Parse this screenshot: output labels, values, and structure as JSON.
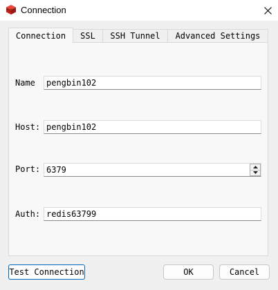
{
  "window": {
    "title": "Connection"
  },
  "tabs": [
    "Connection",
    "SSL",
    "SSH Tunnel",
    "Advanced Settings"
  ],
  "form": {
    "name": {
      "label": "Name",
      "value": "pengbin102"
    },
    "host": {
      "label": "Host:",
      "value": "pengbin102"
    },
    "port": {
      "label": "Port:",
      "value": "6379"
    },
    "auth": {
      "label": "Auth:",
      "value": "redis63799"
    }
  },
  "buttons": {
    "test": "Test Connection",
    "ok": "OK",
    "cancel": "Cancel"
  },
  "icons": {
    "app": "redis-cube-icon",
    "close": "close-icon",
    "spin_up": "spin-up-icon",
    "spin_down": "spin-down-icon"
  },
  "colors": {
    "app_icon": "#d52a1f",
    "focus_border": "#0067c0"
  }
}
